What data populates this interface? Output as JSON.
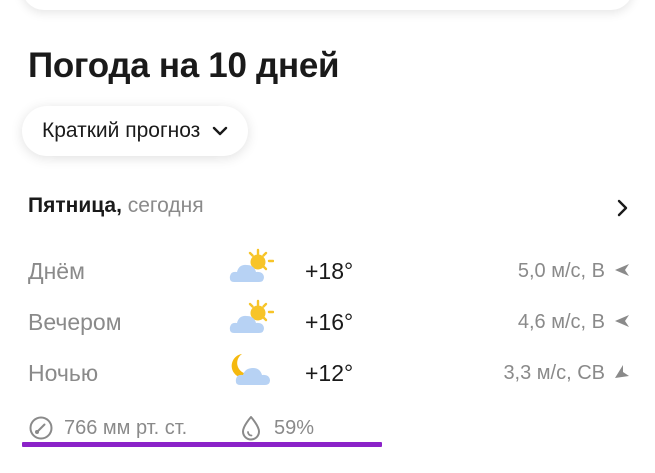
{
  "title": "Погода на 10 дней",
  "forecast_mode": {
    "selected": "Краткий прогноз",
    "icon": "chevron-down-icon"
  },
  "day": {
    "weekday": "Пятница,",
    "relative": "сегодня",
    "icon": "chevron-right-icon"
  },
  "periods": [
    {
      "name": "Днём",
      "condition_icon": "partly-cloudy-day-icon",
      "temperature": "+18°",
      "wind": "5,0 м/с, В",
      "wind_icon": "wind-direction-arrow-icon"
    },
    {
      "name": "Вечером",
      "condition_icon": "partly-cloudy-day-icon",
      "temperature": "+16°",
      "wind": "4,6 м/с, В",
      "wind_icon": "wind-direction-arrow-icon"
    },
    {
      "name": "Ночью",
      "condition_icon": "partly-cloudy-night-icon",
      "temperature": "+12°",
      "wind": "3,3 м/с, СВ",
      "wind_icon": "wind-direction-arrow-icon"
    }
  ],
  "pressure": {
    "icon": "pressure-gauge-icon",
    "value": "766 мм рт. ст."
  },
  "humidity": {
    "icon": "water-drop-icon",
    "value": "59%"
  },
  "colors": {
    "text_primary": "#1a1a1a",
    "text_secondary": "#8a8a8a",
    "highlight_underline": "#8b22c8",
    "sun": "#f7c428",
    "cloud": "#b7d2f4",
    "moon": "#f5b90f"
  }
}
